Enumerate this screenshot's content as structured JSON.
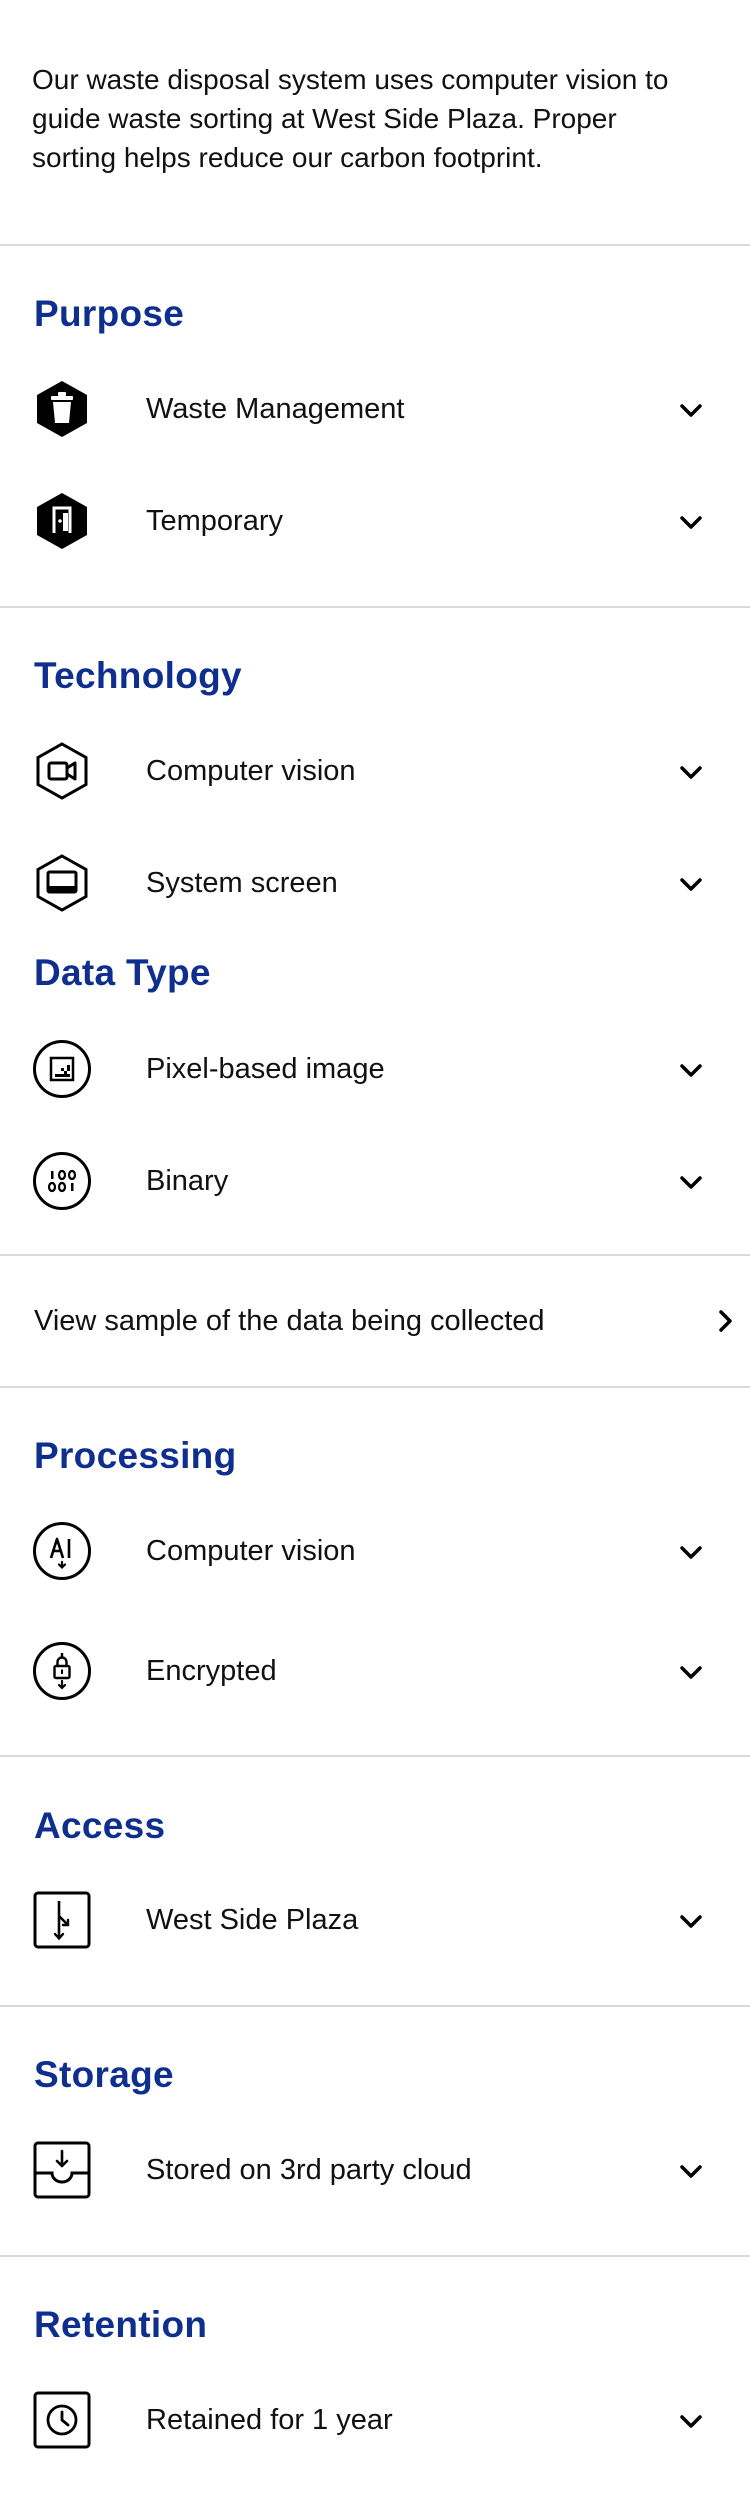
{
  "intro": {
    "line1": "Our waste disposal system uses computer vision to",
    "line2": "guide waste sorting at West Side Plaza. Proper",
    "line3": "sorting helps reduce our carbon footprint."
  },
  "sections": {
    "purpose": {
      "title": "Purpose",
      "items": [
        {
          "label": "Waste Management",
          "icon": "trash-bin-icon"
        },
        {
          "label": "Temporary",
          "icon": "exit-door-icon"
        }
      ]
    },
    "technology": {
      "title": "Technology",
      "items": [
        {
          "label": "Computer vision",
          "icon": "video-camera-icon"
        },
        {
          "label": "System screen",
          "icon": "monitor-screen-icon"
        }
      ]
    },
    "data_type": {
      "title": "Data Type",
      "items": [
        {
          "label": "Pixel-based image",
          "icon": "pixel-image-icon"
        },
        {
          "label": "Binary",
          "icon": "binary-digits-icon"
        }
      ]
    },
    "sample_link": {
      "label": "View sample of the data being collected"
    },
    "processing": {
      "title": "Processing",
      "items": [
        {
          "label": "Computer vision",
          "icon": "ai-processing-icon"
        },
        {
          "label": "Encrypted",
          "icon": "encryption-lock-icon"
        }
      ]
    },
    "access": {
      "title": "Access",
      "items": [
        {
          "label": "West Side Plaza",
          "icon": "access-branch-icon"
        }
      ]
    },
    "storage": {
      "title": "Storage",
      "items": [
        {
          "label": "Stored on 3rd party cloud",
          "icon": "storage-tray-icon"
        }
      ]
    },
    "retention": {
      "title": "Retention",
      "items": [
        {
          "label": "Retained for 1 year",
          "icon": "clock-icon"
        }
      ]
    }
  },
  "colors": {
    "heading": "#0f2f8f",
    "text": "#111111",
    "divider": "#d9d9d9",
    "icon": "#000000"
  }
}
